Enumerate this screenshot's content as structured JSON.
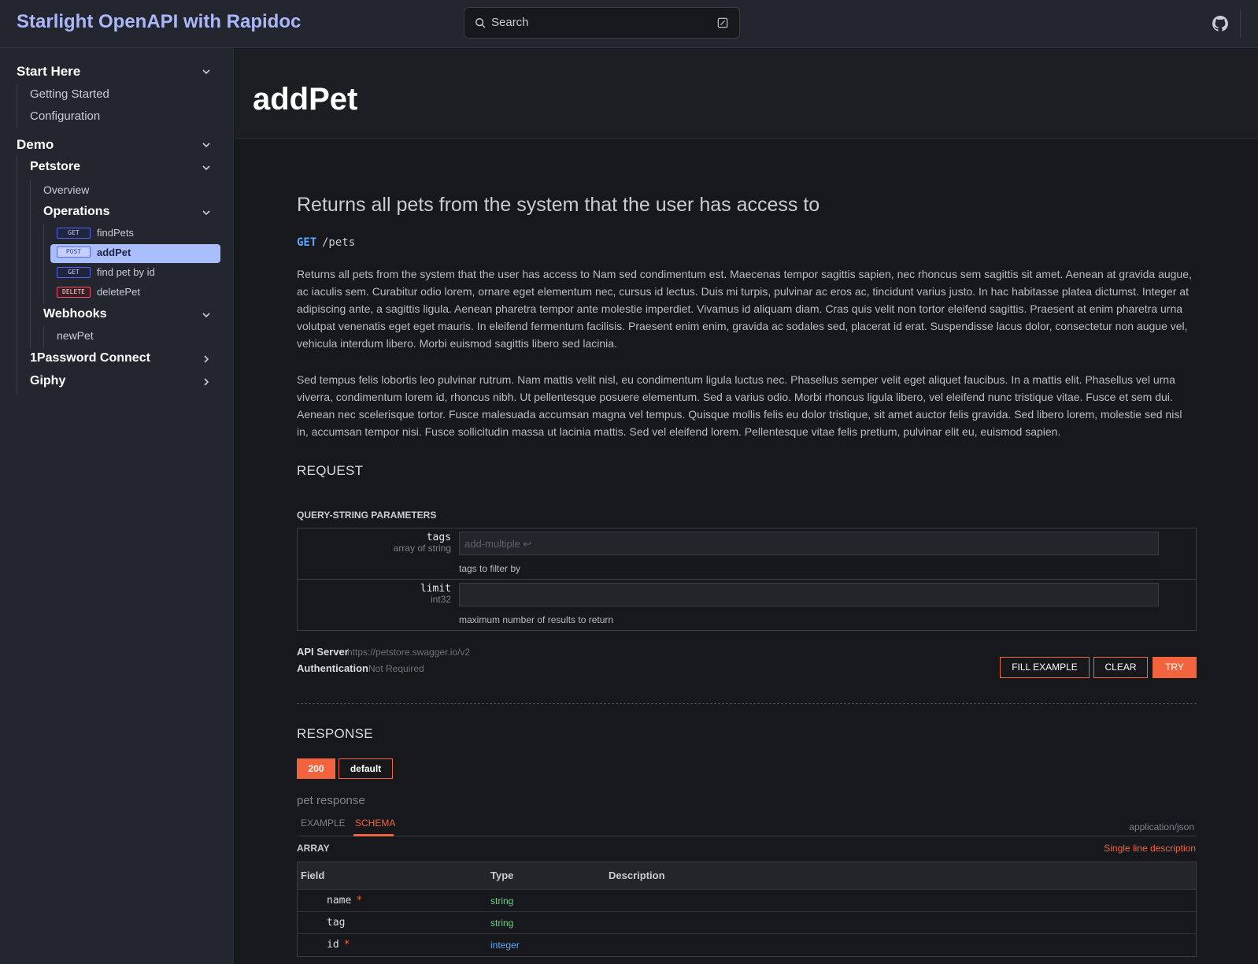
{
  "header": {
    "site_title": "Starlight OpenAPI with Rapidoc",
    "search_label": "Search"
  },
  "sidebar": {
    "start_here": "Start Here",
    "getting_started": "Getting Started",
    "configuration": "Configuration",
    "demo": "Demo",
    "petstore": "Petstore",
    "overview": "Overview",
    "operations": "Operations",
    "ops": [
      {
        "method": "GET",
        "label": "findPets"
      },
      {
        "method": "POST",
        "label": "addPet"
      },
      {
        "method": "GET",
        "label": "find pet by id"
      },
      {
        "method": "DELETE",
        "label": "deletePet"
      }
    ],
    "webhooks": "Webhooks",
    "new_pet": "newPet",
    "onepassword": "1Password Connect",
    "giphy": "Giphy"
  },
  "page": {
    "title": "addPet",
    "summary": "Returns all pets from the system that the user has access to",
    "method": "GET",
    "path": "/pets",
    "desc1": "Returns all pets from the system that the user has access to Nam sed condimentum est. Maecenas tempor sagittis sapien, nec rhoncus sem sagittis sit amet. Aenean at gravida augue, ac iaculis sem. Curabitur odio lorem, ornare eget elementum nec, cursus id lectus. Duis mi turpis, pulvinar ac eros ac, tincidunt varius justo. In hac habitasse platea dictumst. Integer at adipiscing ante, a sagittis ligula. Aenean pharetra tempor ante molestie imperdiet. Vivamus id aliquam diam. Cras quis velit non tortor eleifend sagittis. Praesent at enim pharetra urna volutpat venenatis eget eget mauris. In eleifend fermentum facilisis. Praesent enim enim, gravida ac sodales sed, placerat id erat. Suspendisse lacus dolor, consectetur non augue vel, vehicula interdum libero. Morbi euismod sagittis libero sed lacinia.",
    "desc2": "Sed tempus felis lobortis leo pulvinar rutrum. Nam mattis velit nisl, eu condimentum ligula luctus nec. Phasellus semper velit eget aliquet faucibus. In a mattis elit. Phasellus vel urna viverra, condimentum lorem id, rhoncus nibh. Ut pellentesque posuere elementum. Sed a varius odio. Morbi rhoncus ligula libero, vel eleifend nunc tristique vitae. Fusce et sem dui. Aenean nec scelerisque tortor. Fusce malesuada accumsan magna vel tempus. Quisque mollis felis eu dolor tristique, sit amet auctor felis gravida. Sed libero lorem, molestie sed nisl in, accumsan tempor nisi. Fusce sollicitudin massa ut lacinia mattis. Sed vel eleifend lorem. Pellentesque vitae felis pretium, pulvinar elit eu, euismod sapien."
  },
  "request": {
    "heading": "REQUEST",
    "query_heading": "QUERY-STRING PARAMETERS",
    "params": [
      {
        "name": "tags",
        "type": "array of string",
        "placeholder": "add-multiple ↩",
        "value": "",
        "description": "tags to filter by"
      },
      {
        "name": "limit",
        "type": "int32",
        "placeholder": "",
        "value": "",
        "description": "maximum number of results to return"
      }
    ],
    "api_server_label": "API Server",
    "api_server_value": "https://petstore.swagger.io/v2",
    "auth_label": "Authentication",
    "auth_value": "Not Required",
    "fill_example": "FILL EXAMPLE",
    "clear": "CLEAR",
    "try": "TRY"
  },
  "response": {
    "heading": "RESPONSE",
    "tab_200": "200",
    "tab_default": "default",
    "description": "pet response",
    "tab_example": "EXAMPLE",
    "tab_schema": "SCHEMA",
    "mime": "application/json",
    "array_label": "ARRAY",
    "single_line": "Single line description",
    "columns": [
      "Field",
      "Type",
      "Description"
    ],
    "fields": [
      {
        "name": "name",
        "required": true,
        "type": "string"
      },
      {
        "name": "tag",
        "required": false,
        "type": "string"
      },
      {
        "name": "id",
        "required": true,
        "type": "integer"
      }
    ]
  },
  "colors": {
    "accent": "#f2643d",
    "brand": "#aab7f8",
    "get": "#5aa9ff",
    "active_bg": "#aabdfd"
  }
}
